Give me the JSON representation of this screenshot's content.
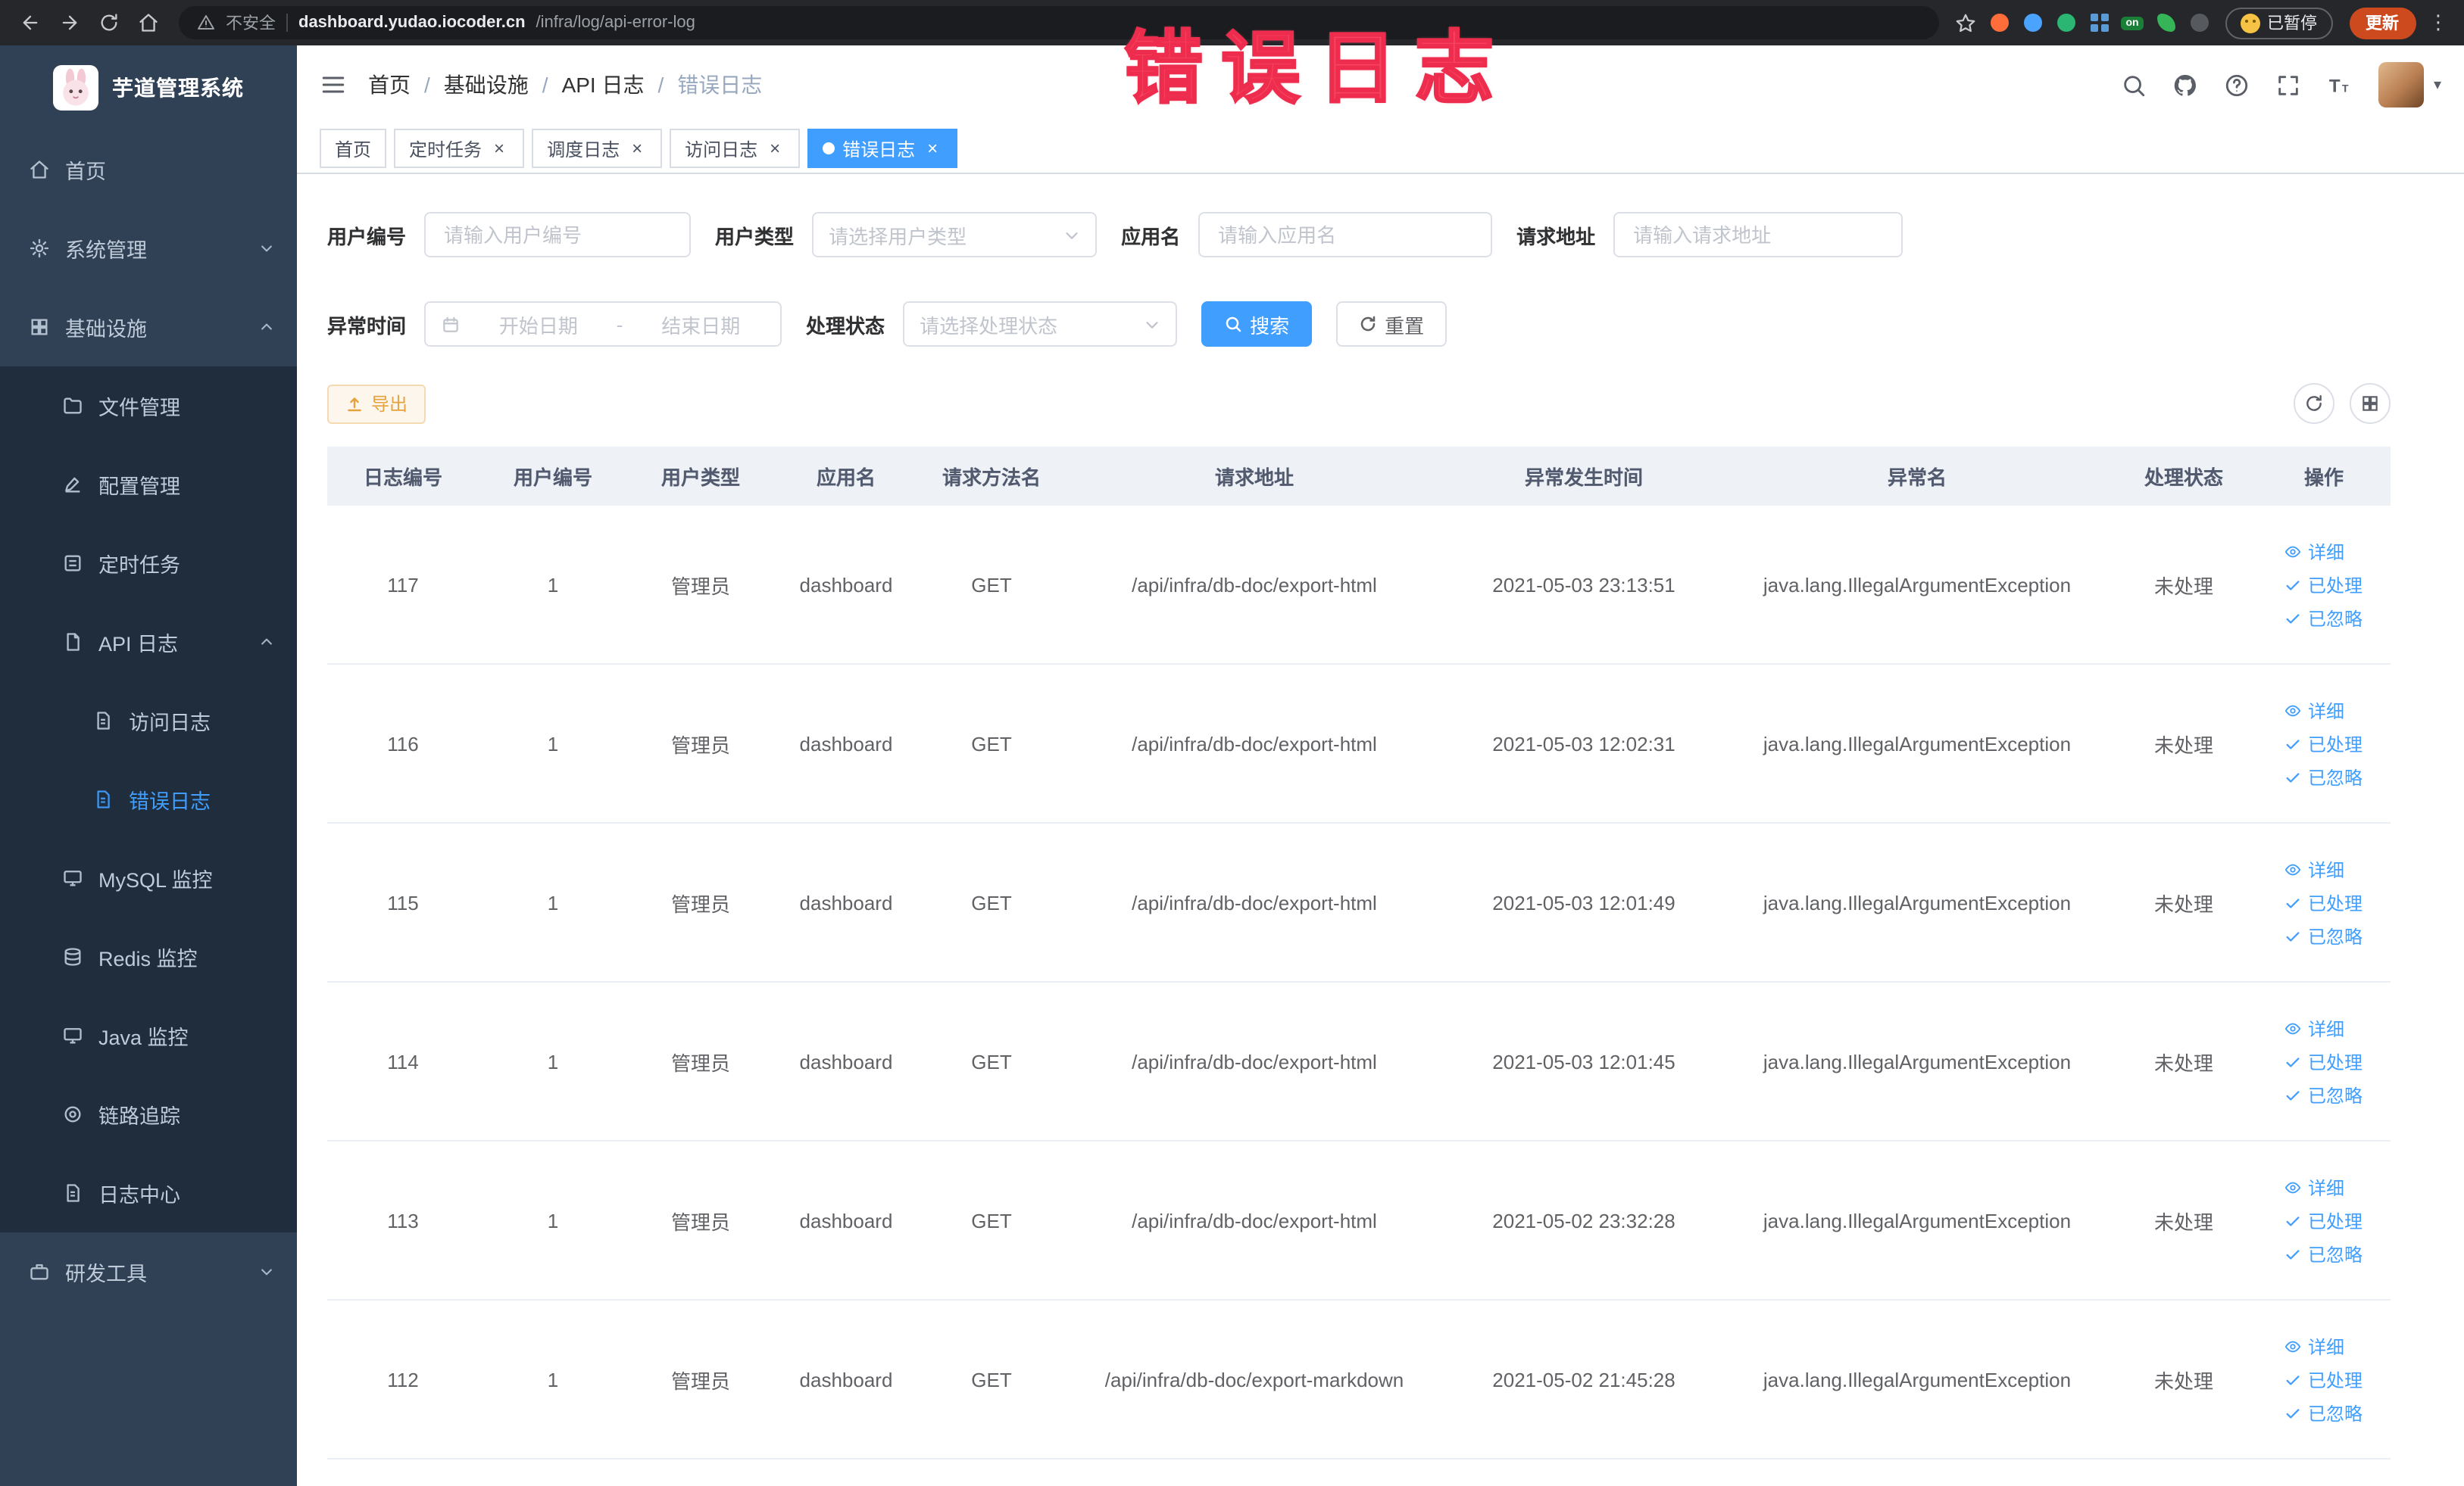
{
  "theme": {
    "primary": "#409eff",
    "warning": "#e6a23c",
    "sidebar_bg": "#304156",
    "submenu_bg": "#1f2d3d",
    "table_header_bg": "#eef1f6",
    "annotation_color": "#f8455f"
  },
  "icons": {
    "close": "×",
    "kebab": "⋮",
    "caret": "▾",
    "range_separator": "-",
    "breadcrumb_separator": "/"
  },
  "browser": {
    "security_label": "不安全",
    "url_host": "dashboard.yudao.iocoder.cn",
    "url_path": "/infra/log/api-error-log",
    "on_badge": "on",
    "paused_badge": "已暂停",
    "update_button": "更新"
  },
  "annotation": {
    "text": "错误日志"
  },
  "sidebar": {
    "logo_title": "芋道管理系统",
    "items": [
      {
        "label": "首页"
      },
      {
        "label": "系统管理"
      },
      {
        "label": "基础设施"
      },
      {
        "label": "文件管理"
      },
      {
        "label": "配置管理"
      },
      {
        "label": "定时任务"
      },
      {
        "label": "API 日志"
      },
      {
        "label": "访问日志"
      },
      {
        "label": "错误日志"
      },
      {
        "label": "MySQL 监控"
      },
      {
        "label": "Redis 监控"
      },
      {
        "label": "Java 监控"
      },
      {
        "label": "链路追踪"
      },
      {
        "label": "日志中心"
      },
      {
        "label": "研发工具"
      }
    ]
  },
  "breadcrumb": {
    "items": [
      "首页",
      "基础设施",
      "API 日志",
      "错误日志"
    ]
  },
  "tabs": [
    {
      "label": "首页"
    },
    {
      "label": "定时任务"
    },
    {
      "label": "调度日志"
    },
    {
      "label": "访问日志"
    },
    {
      "label": "错误日志"
    }
  ],
  "filters": {
    "user_id": {
      "label": "用户编号",
      "placeholder": "请输入用户编号"
    },
    "user_type": {
      "label": "用户类型",
      "placeholder": "请选择用户类型"
    },
    "app_name": {
      "label": "应用名",
      "placeholder": "请输入应用名"
    },
    "request_url": {
      "label": "请求地址",
      "placeholder": "请输入请求地址"
    },
    "exception_time": {
      "label": "异常时间",
      "start_placeholder": "开始日期",
      "end_placeholder": "结束日期"
    },
    "status": {
      "label": "处理状态",
      "placeholder": "请选择处理状态"
    },
    "search_label": "搜索",
    "reset_label": "重置"
  },
  "toolbar": {
    "export_label": "导出"
  },
  "table": {
    "columns": [
      "日志编号",
      "用户编号",
      "用户类型",
      "应用名",
      "请求方法名",
      "请求地址",
      "异常发生时间",
      "异常名",
      "处理状态",
      "操作"
    ],
    "action_labels": {
      "detail": "详细",
      "processed": "已处理",
      "ignored": "已忽略"
    },
    "rows": [
      {
        "id": "117",
        "user_id": "1",
        "user_type": "管理员",
        "app": "dashboard",
        "method": "GET",
        "url": "/api/infra/db-doc/export-html",
        "time": "2021-05-03 23:13:51",
        "exception": "java.lang.IllegalArgumentException",
        "status": "未处理"
      },
      {
        "id": "116",
        "user_id": "1",
        "user_type": "管理员",
        "app": "dashboard",
        "method": "GET",
        "url": "/api/infra/db-doc/export-html",
        "time": "2021-05-03 12:02:31",
        "exception": "java.lang.IllegalArgumentException",
        "status": "未处理"
      },
      {
        "id": "115",
        "user_id": "1",
        "user_type": "管理员",
        "app": "dashboard",
        "method": "GET",
        "url": "/api/infra/db-doc/export-html",
        "time": "2021-05-03 12:01:49",
        "exception": "java.lang.IllegalArgumentException",
        "status": "未处理"
      },
      {
        "id": "114",
        "user_id": "1",
        "user_type": "管理员",
        "app": "dashboard",
        "method": "GET",
        "url": "/api/infra/db-doc/export-html",
        "time": "2021-05-03 12:01:45",
        "exception": "java.lang.IllegalArgumentException",
        "status": "未处理"
      },
      {
        "id": "113",
        "user_id": "1",
        "user_type": "管理员",
        "app": "dashboard",
        "method": "GET",
        "url": "/api/infra/db-doc/export-html",
        "time": "2021-05-02 23:32:28",
        "exception": "java.lang.IllegalArgumentException",
        "status": "未处理"
      },
      {
        "id": "112",
        "user_id": "1",
        "user_type": "管理员",
        "app": "dashboard",
        "method": "GET",
        "url": "/api/infra/db-doc/export-markdown",
        "time": "2021-05-02 21:45:28",
        "exception": "java.lang.IllegalArgumentException",
        "status": "未处理"
      }
    ]
  }
}
